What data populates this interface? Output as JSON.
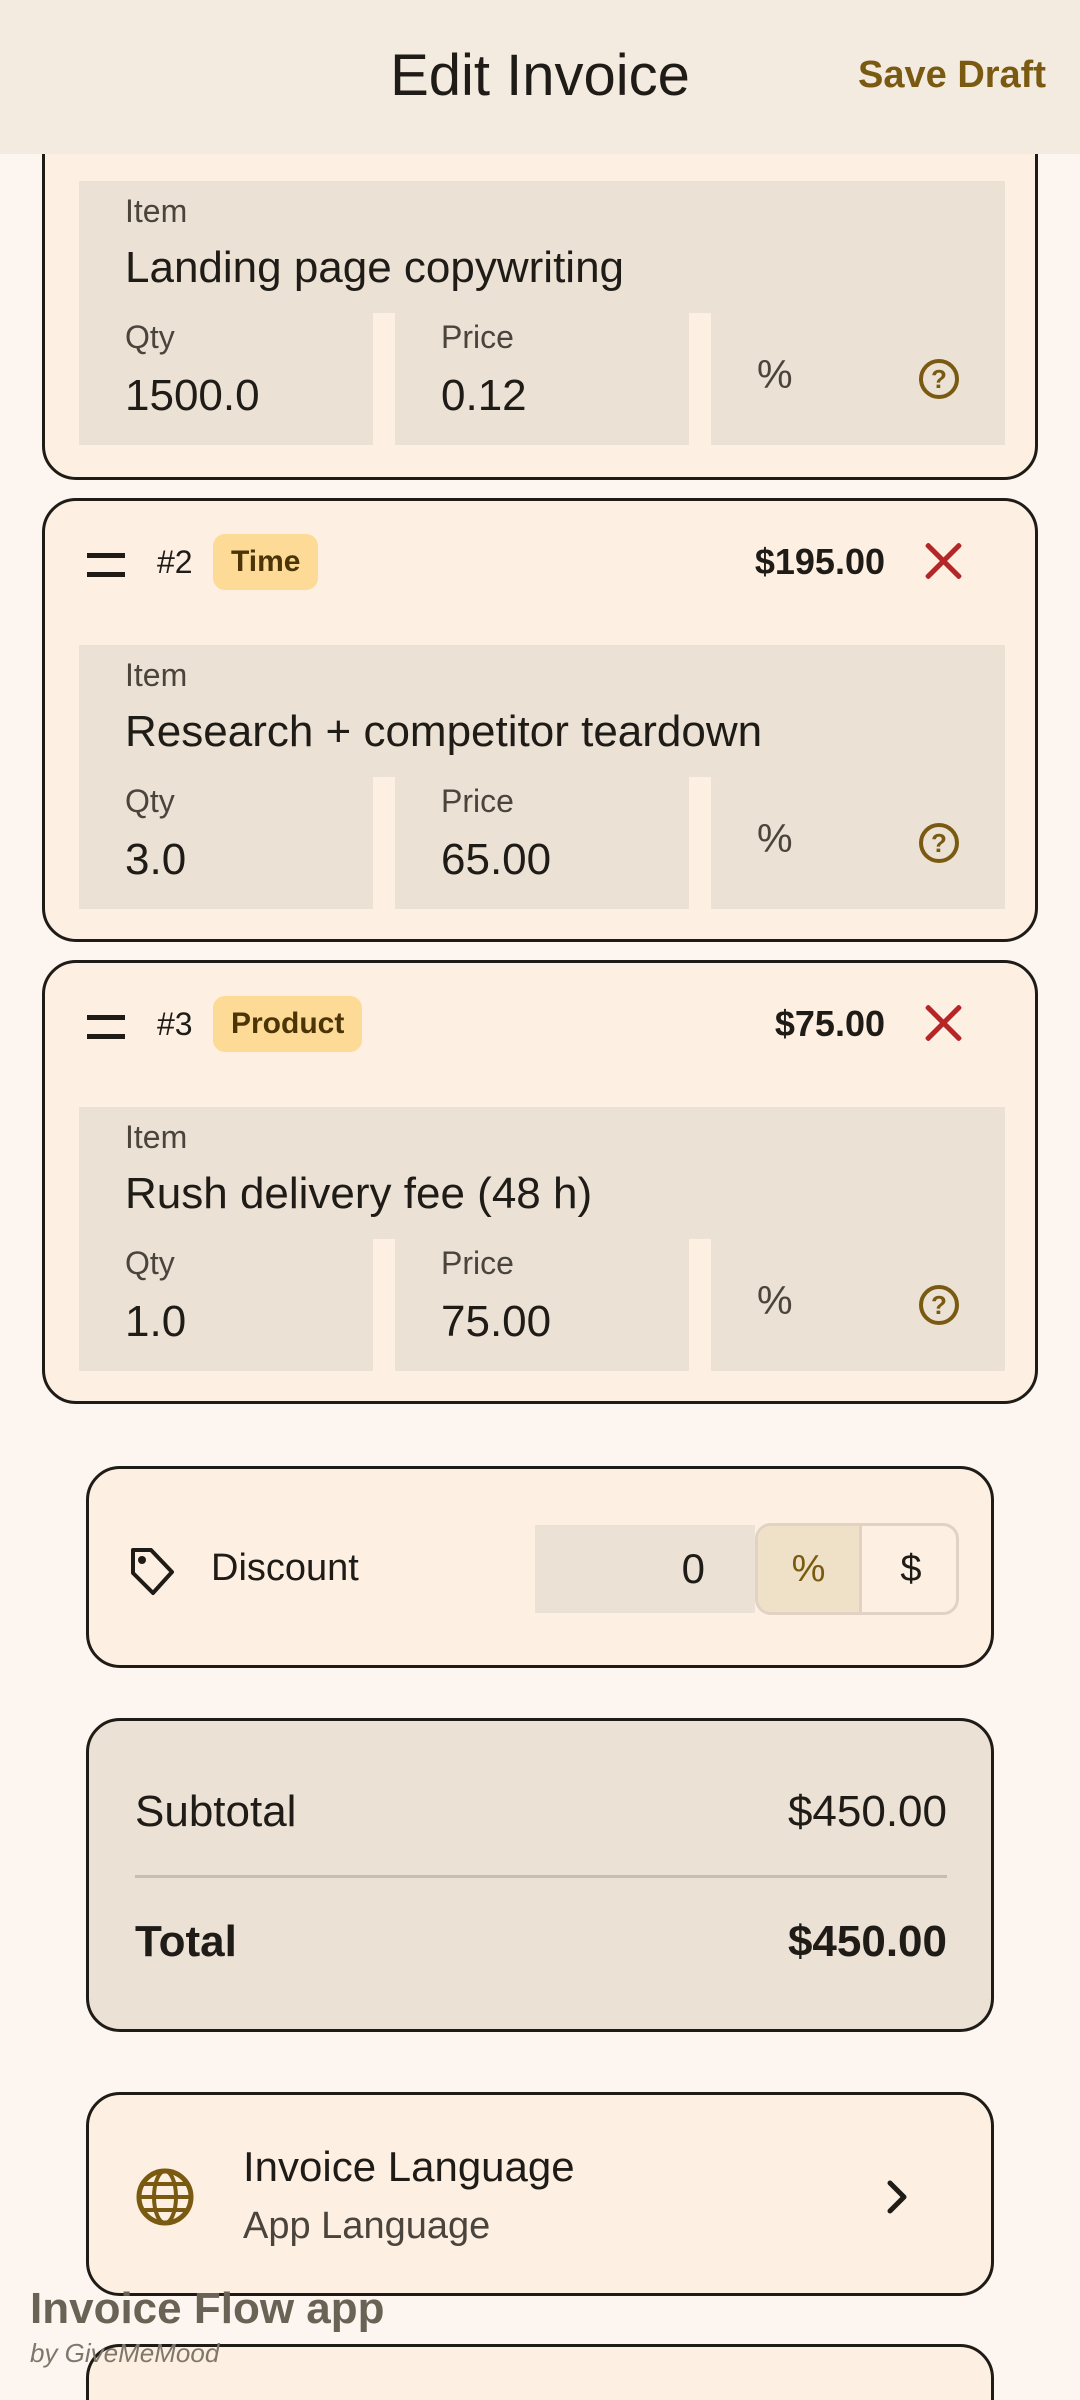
{
  "appbar": {
    "title": "Edit Invoice",
    "save_label": "Save Draft"
  },
  "items": [
    {
      "number": "",
      "type": "",
      "amount": "",
      "item_label": "Item",
      "item": "Landing page copywriting",
      "qty_label": "Qty",
      "qty": "1500.0",
      "price_label": "Price",
      "price": "0.12",
      "percent": "%"
    },
    {
      "number": "#2",
      "type": "Time",
      "amount": "$195.00",
      "item_label": "Item",
      "item": "Research + competitor teardown",
      "qty_label": "Qty",
      "qty": "3.0",
      "price_label": "Price",
      "price": "65.00",
      "percent": "%"
    },
    {
      "number": "#3",
      "type": "Product",
      "amount": "$75.00",
      "item_label": "Item",
      "item": "Rush delivery fee (48 h)",
      "qty_label": "Qty",
      "qty": "1.0",
      "price_label": "Price",
      "price": "75.00",
      "percent": "%"
    }
  ],
  "discount": {
    "label": "Discount",
    "value": "0",
    "percent_option": "%",
    "dollar_option": "$",
    "selected": "%"
  },
  "totals": {
    "subtotal_label": "Subtotal",
    "subtotal": "$450.00",
    "total_label": "Total",
    "total": "$450.00"
  },
  "language": {
    "title": "Invoice Language",
    "value": "App Language"
  },
  "watermark": {
    "app": "Invoice Flow app",
    "by": "by GiveMeMood"
  },
  "colors": {
    "accent": "#7a5a10",
    "delete": "#b52626",
    "badge": "#fddb97",
    "field": "#ebe1d5",
    "card": "#fdf0e3"
  },
  "icons": [
    "drag-handle-icon",
    "close-icon",
    "help-icon",
    "tag-icon",
    "globe-icon",
    "chevron-right-icon"
  ]
}
